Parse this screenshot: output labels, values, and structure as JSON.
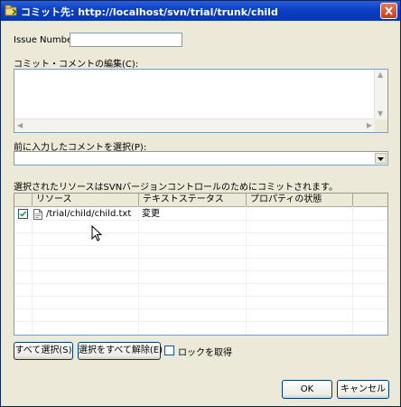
{
  "window": {
    "title": "コミット先: http://localhost/svn/trial/trunk/child"
  },
  "issue": {
    "label": "Issue Number:",
    "value": ""
  },
  "comment": {
    "label": "コミット・コメントの編集(C):",
    "value": ""
  },
  "previous": {
    "label": "前に入力したコメントを選択(P):",
    "selected": ""
  },
  "resources": {
    "caption": "選択されたリソースはSVNバージョンコントロールのためにコミットされます。",
    "columns": [
      "リソース",
      "テキストステータス",
      "プロパティの状態"
    ],
    "rows": [
      {
        "checked": true,
        "path": "/trial/child/child.txt",
        "text_status": "変更",
        "prop_status": ""
      }
    ]
  },
  "buttons": {
    "select_all": "すべて選択(S)",
    "deselect_all": "選択をすべて解除(E)",
    "lock_label": "ロックを取得",
    "ok": "OK",
    "cancel": "キャンセル"
  },
  "icons": {
    "title": "subversion-icon",
    "file": "file-icon",
    "close": "close-icon"
  }
}
